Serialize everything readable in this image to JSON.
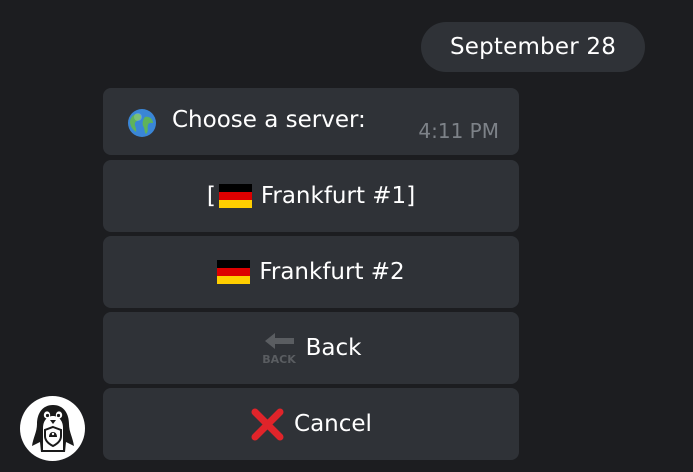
{
  "date_separator": "September 28",
  "message": {
    "icon": "globe-icon",
    "text": "Choose a server:",
    "time": "4:11 PM"
  },
  "keyboard": [
    {
      "prefix": "[",
      "icon": "germany-flag-icon",
      "label": "Frankfurt #1",
      "suffix": "]"
    },
    {
      "icon": "germany-flag-icon",
      "label": "Frankfurt #2"
    },
    {
      "icon": "back-arrow-icon",
      "icon_text": "BACK",
      "label": "Back"
    },
    {
      "icon": "red-cross-icon",
      "label": "Cancel"
    }
  ],
  "avatar": {
    "icon": "penguin-shield-icon"
  },
  "colors": {
    "background": "#1c1d20",
    "bubble": "#2f3237",
    "time_text": "#7d8288",
    "flag_black": "#000000",
    "flag_red": "#dd0000",
    "flag_gold": "#ffce00",
    "cancel_red": "#e0242a"
  }
}
